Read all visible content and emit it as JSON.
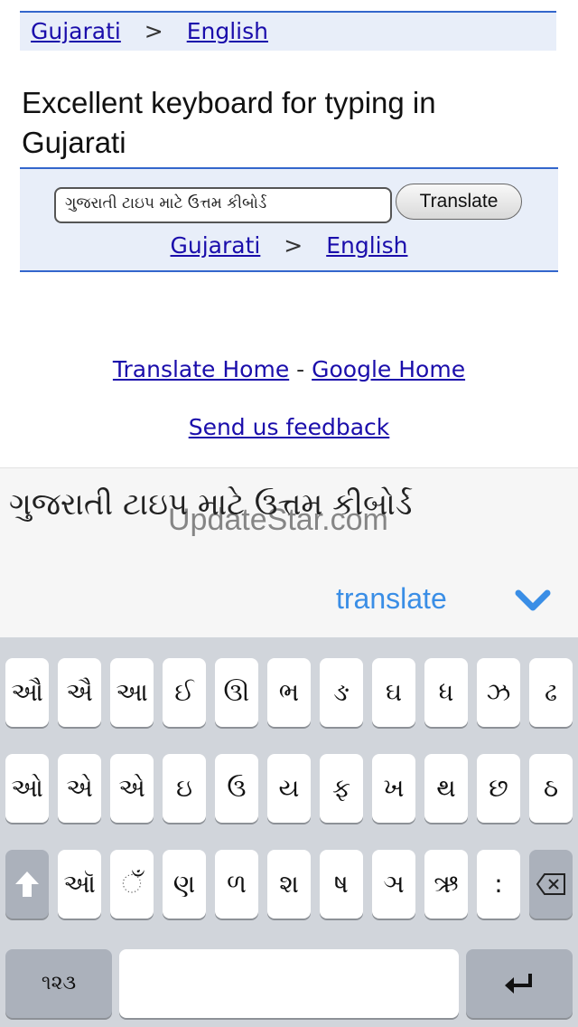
{
  "top_lang_bar": {
    "from": "Gujarati",
    "sep": ">",
    "to": "English"
  },
  "page_title": "Excellent keyboard for typing in Gujarati",
  "translate_box": {
    "input_value": "ગુજરાતી ટાઇપ માટે ઉત્તમ કીબોર્ડ",
    "button_label": "Translate",
    "lang_from": "Gujarati",
    "lang_sep": ">",
    "lang_to": "English"
  },
  "footer": {
    "translate_home": "Translate Home",
    "dash": "-",
    "google_home": "Google Home",
    "feedback": "Send us feedback"
  },
  "suggestion": {
    "text": "ગુજરાતી ટાઇપ માટે ઉત્તમ કીબોર્ડ",
    "watermark": "UpdateStar.com",
    "translate_label": "translate",
    "chevron_icon": "chevron-down-icon"
  },
  "keyboard": {
    "row1": [
      "ઔ",
      "ઐ",
      "આ",
      "ઈ",
      "ઊ",
      "ભ",
      "ઙ",
      "ઘ",
      "ધ",
      "ઝ",
      "ઢ"
    ],
    "row2": [
      "ઓ",
      "એ",
      "એ",
      "ઇ",
      "ઉ",
      "ય",
      "ફ",
      "ખ",
      "થ",
      "છ",
      "ઠ"
    ],
    "row3": [
      "ઑ",
      "ઁ",
      "ણ",
      "ળ",
      "શ",
      "ષ",
      "ઞ",
      "ઋ",
      ":"
    ],
    "numbers_key": "૧૨૩",
    "space_label": "",
    "shift_icon": "shift-icon",
    "delete_icon": "delete-icon",
    "return_icon": "return-icon"
  }
}
